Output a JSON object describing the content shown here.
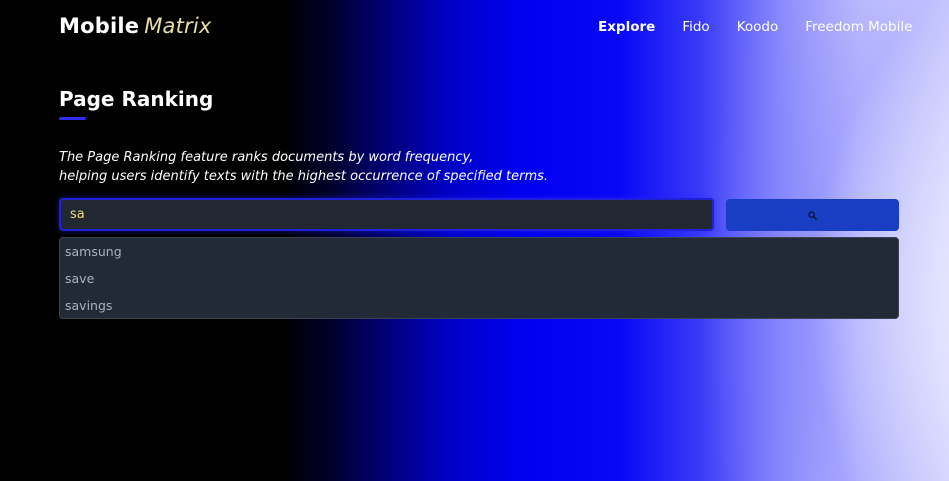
{
  "header": {
    "logo_main": "Mobile",
    "logo_accent": "Matrix",
    "nav": [
      {
        "label": "Explore",
        "active": true
      },
      {
        "label": "Fido",
        "active": false
      },
      {
        "label": "Koodo",
        "active": false
      },
      {
        "label": "Freedom Mobile",
        "active": false
      }
    ]
  },
  "main": {
    "title": "Page Ranking",
    "description_line1": "The Page Ranking feature ranks documents by word frequency,",
    "description_line2": "helping users identify texts with the highest occurrence of specified terms.",
    "search": {
      "value": "sa",
      "button_icon": "search-icon"
    },
    "suggestions": [
      "samsung",
      "save",
      "savings"
    ]
  },
  "colors": {
    "accent": "#2f2cf5",
    "input_text": "#e9dc7c",
    "logo_accent": "#e8dfa8",
    "button": "#1a3ec3",
    "panel": "#232a37"
  }
}
